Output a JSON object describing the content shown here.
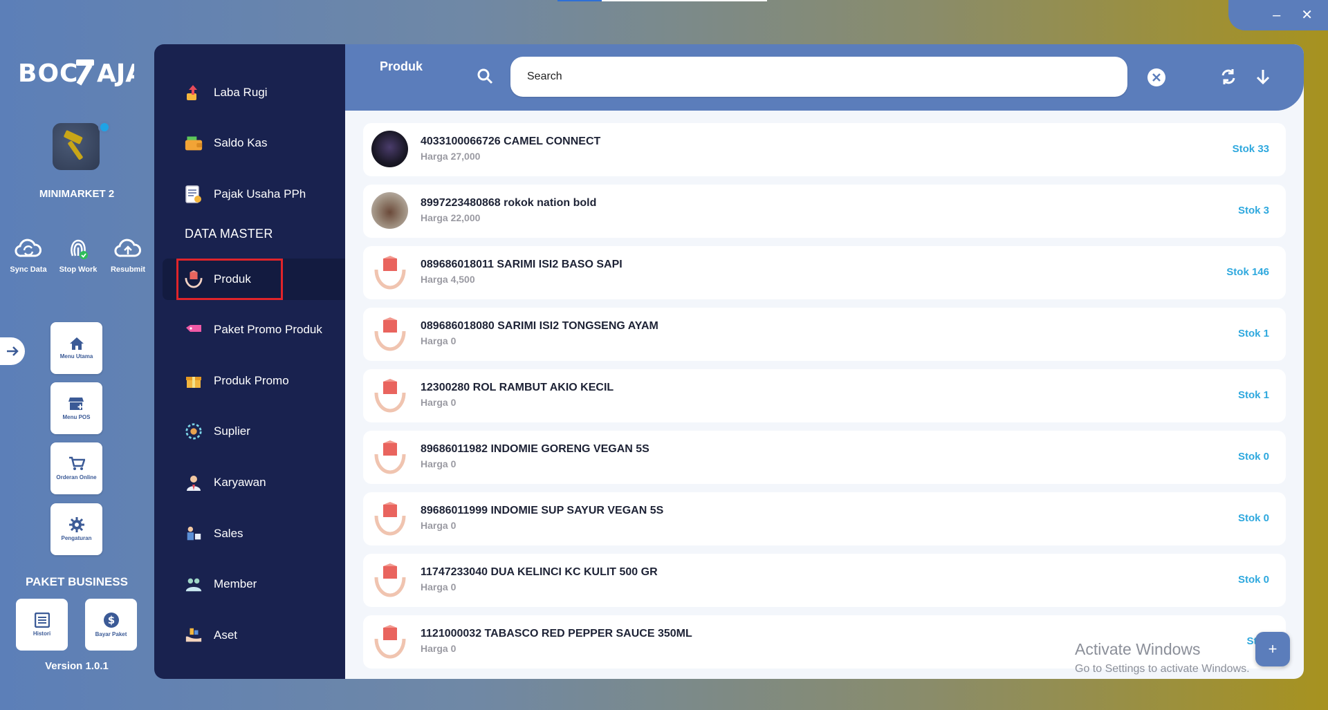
{
  "app": {
    "logo_text": "BOC AJA",
    "store_name": "MINIMARKET 2",
    "quick_actions": [
      "Sync Data",
      "Stop Work",
      "Resubmit"
    ],
    "tiles": [
      "Menu Utama",
      "Menu POS",
      "Orderan Online",
      "Pengaturan"
    ],
    "paket_title": "PAKET BUSINESS",
    "paket_tiles": [
      "Histori",
      "Bayar Paket"
    ],
    "version": "Version 1.0.1"
  },
  "window_controls": {
    "minimize": "–",
    "close": "✕"
  },
  "nav": {
    "items_top": [
      "Laba Rugi",
      "Saldo Kas",
      "Pajak Usaha PPh"
    ],
    "section": "DATA MASTER",
    "items_master": [
      "Produk",
      "Paket Promo Produk",
      "Produk Promo",
      "Suplier",
      "Karyawan",
      "Sales",
      "Member",
      "Aset"
    ],
    "active": "Produk"
  },
  "header": {
    "title": "Produk",
    "search_placeholder": "Search"
  },
  "products": [
    {
      "name": "4033100066726 CAMEL CONNECT",
      "price": "Harga 27,000",
      "stok": "Stok 33",
      "thumb": "photo-dark"
    },
    {
      "name": "8997223480868 rokok nation bold",
      "price": "Harga 22,000",
      "stok": "Stok 3",
      "thumb": "photo"
    },
    {
      "name": "089686018011 SARIMI ISI2 BASO SAPI",
      "price": "Harga 4,500",
      "stok": "Stok 146",
      "thumb": "product-icon"
    },
    {
      "name": "089686018080 SARIMI ISI2 TONGSENG AYAM",
      "price": "Harga 0",
      "stok": "Stok 1",
      "thumb": "product-icon"
    },
    {
      "name": "12300280 ROL RAMBUT AKIO KECIL",
      "price": "Harga 0",
      "stok": "Stok 1",
      "thumb": "product-icon"
    },
    {
      "name": "89686011982 INDOMIE GORENG VEGAN 5S",
      "price": "Harga 0",
      "stok": "Stok 0",
      "thumb": "product-icon"
    },
    {
      "name": "89686011999 INDOMIE SUP SAYUR VEGAN 5S",
      "price": "Harga 0",
      "stok": "Stok 0",
      "thumb": "product-icon"
    },
    {
      "name": "11747233040 DUA KELINCI KC KULIT 500 GR",
      "price": "Harga 0",
      "stok": "Stok 0",
      "thumb": "product-icon"
    },
    {
      "name": "1121000032 TABASCO RED PEPPER SAUCE 350ML",
      "price": "Harga 0",
      "stok": "Stok",
      "thumb": "product-icon"
    }
  ],
  "fab_label": "+",
  "watermark": {
    "line1": "Activate Windows",
    "line2": "Go to Settings to activate Windows."
  },
  "colors": {
    "nav_bg": "#19224f",
    "header_bg": "#5b7dbb",
    "stok_text": "#2ea8de",
    "highlight": "#e0242a"
  }
}
